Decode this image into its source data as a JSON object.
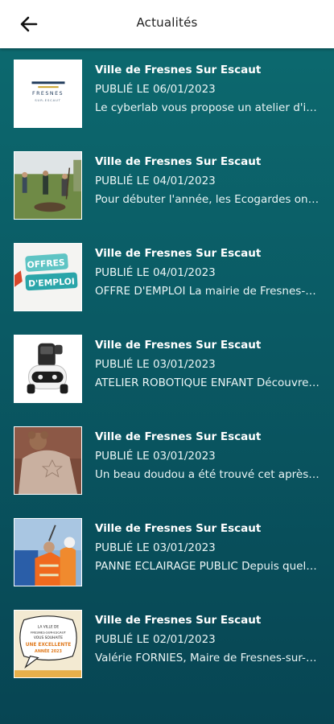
{
  "header": {
    "title": "Actualités",
    "back_icon": "arrow-left-icon"
  },
  "news": [
    {
      "source": "Ville de Fresnes Sur Escaut",
      "date": "PUBLIÉ LE 06/01/2023",
      "excerpt": "Le cyberlab vous propose un atelier d'initiation au numérique",
      "thumbnail": "fresnes-logo-image",
      "logo_text": "FRESNES",
      "logo_sub": "SUR-ESCAUT"
    },
    {
      "source": "Ville de Fresnes Sur Escaut",
      "date": "PUBLIÉ LE 04/01/2023",
      "excerpt": "Pour débuter l'année, les Ecogardes ont planté des arbres",
      "thumbnail": "ecogardes-planting-photo"
    },
    {
      "source": "Ville de Fresnes Sur Escaut",
      "date": "PUBLIÉ LE 04/01/2023",
      "excerpt": "OFFRE D'EMPLOI La mairie de Fresnes-sur-Escaut recrute",
      "thumbnail": "job-offer-image",
      "offer_line1": "OFFRES",
      "offer_line2": "D'EMPLOI"
    },
    {
      "source": "Ville de Fresnes Sur Escaut",
      "date": "PUBLIÉ LE 03/01/2023",
      "excerpt": "ATELIER ROBOTIQUE ENFANT Découvrez la robotique",
      "thumbnail": "robot-photo"
    },
    {
      "source": "Ville de Fresnes Sur Escaut",
      "date": "PUBLIÉ LE 03/01/2023",
      "excerpt": "Un beau doudou a été trouvé cet après-midi",
      "thumbnail": "doudou-photo"
    },
    {
      "source": "Ville de Fresnes Sur Escaut",
      "date": "PUBLIÉ LE 03/01/2023",
      "excerpt": "PANNE ECLAIRAGE PUBLIC Depuis quelques jours",
      "thumbnail": "public-lighting-workers-photo"
    },
    {
      "source": "Ville de Fresnes Sur Escaut",
      "date": "PUBLIÉ LE 02/01/2023",
      "excerpt": "Valérie FORNIES, Maire de Fresnes-sur-Escaut vous souhaite",
      "thumbnail": "new-year-wishes-image",
      "wish_line1": "LA VILLE DE",
      "wish_line2": "FRESNES-SUR-ESCAUT",
      "wish_line3": "VOUS SOUHAITE",
      "wish_line4": "UNE EXCELLENTE",
      "wish_line5": "ANNÉE 2023"
    }
  ]
}
